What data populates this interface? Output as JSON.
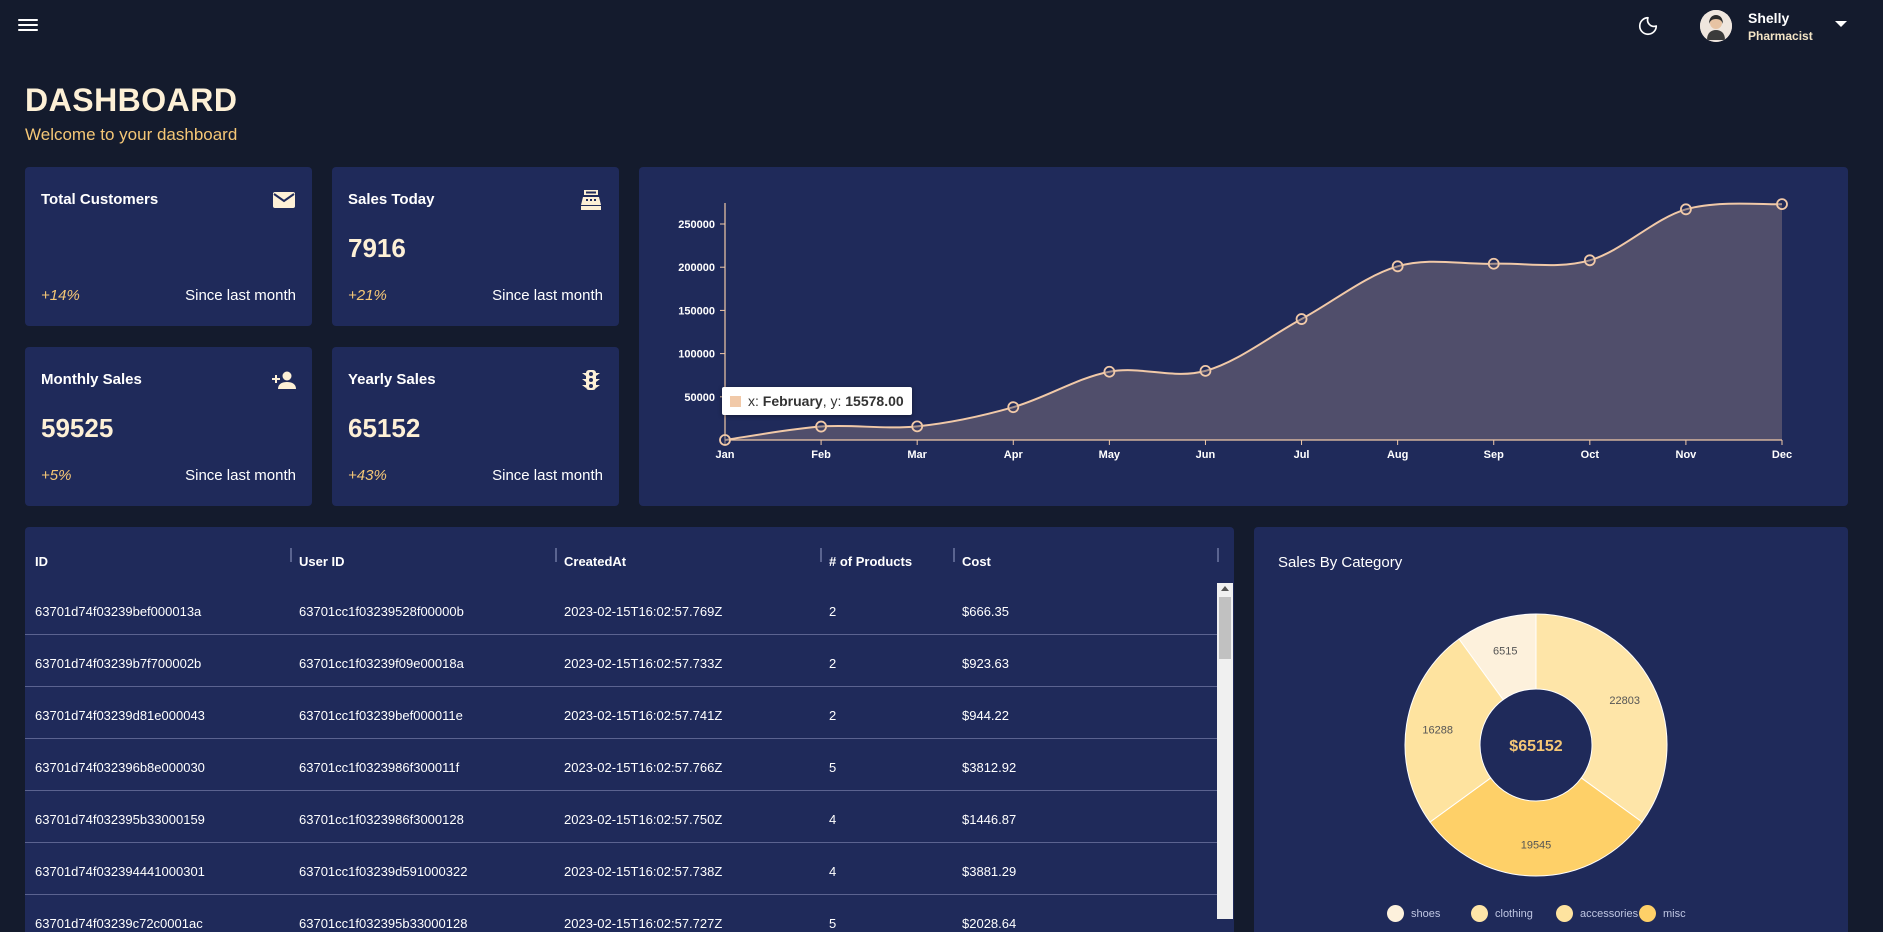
{
  "user": {
    "name": "Shelly",
    "role": "Pharmacist"
  },
  "header": {
    "title": "DASHBOARD",
    "subtitle": "Welcome to your dashboard"
  },
  "stats": [
    {
      "label": "Total Customers",
      "value": "",
      "change": "+14%",
      "since": "Since last month",
      "icon": "mail-icon"
    },
    {
      "label": "Sales Today",
      "value": "7916",
      "change": "+21%",
      "since": "Since last month",
      "icon": "point-of-sale-icon"
    },
    {
      "label": "Monthly Sales",
      "value": "59525",
      "change": "+5%",
      "since": "Since last month",
      "icon": "person-add-icon"
    },
    {
      "label": "Yearly Sales",
      "value": "65152",
      "change": "+43%",
      "since": "Since last month",
      "icon": "traffic-icon"
    }
  ],
  "colors": {
    "background": "#141b2d",
    "panel": "#1f2a5a",
    "accent": "#f5c776",
    "line": "#f1c9a8"
  },
  "chart_data": [
    {
      "type": "area",
      "x": [
        "Jan",
        "Feb",
        "Mar",
        "Apr",
        "May",
        "Jun",
        "Jul",
        "Aug",
        "Sep",
        "Oct",
        "Nov",
        "Dec"
      ],
      "y": [
        0,
        15578,
        15800,
        38000,
        79000,
        80000,
        140000,
        201000,
        204000,
        208000,
        267000,
        273000
      ],
      "y_ticks": [
        50000,
        100000,
        150000,
        200000,
        250000
      ],
      "ylim": [
        0,
        280000
      ],
      "grid": false,
      "tooltip": {
        "prefix_x": "x: ",
        "x": "February",
        "sep": ", y: ",
        "y": "15578.00"
      }
    },
    {
      "type": "pie",
      "title": "Sales By Category",
      "center_label": "$65152",
      "slices": [
        {
          "name": "shoes",
          "value": 6515,
          "color": "#fdf1dc"
        },
        {
          "name": "clothing",
          "value": 22803,
          "color": "#fee5a8"
        },
        {
          "name": "accessories",
          "value": 19545,
          "color": "#fed068"
        },
        {
          "name": "misc",
          "value": 16288,
          "color": "#fee39f"
        }
      ],
      "legend": [
        {
          "name": "shoes",
          "color": "#fdf1dc"
        },
        {
          "name": "clothing",
          "color": "#fee5a8"
        },
        {
          "name": "accessories",
          "color": "#fee39f"
        },
        {
          "name": "misc",
          "color": "#fed068"
        }
      ]
    }
  ],
  "table": {
    "columns": [
      "ID",
      "User ID",
      "CreatedAt",
      "# of Products",
      "Cost"
    ],
    "rows": [
      [
        "63701d74f03239bef000013a",
        "63701cc1f03239528f00000b",
        "2023-02-15T16:02:57.769Z",
        "2",
        "$666.35"
      ],
      [
        "63701d74f03239b7f700002b",
        "63701cc1f03239f09e00018a",
        "2023-02-15T16:02:57.733Z",
        "2",
        "$923.63"
      ],
      [
        "63701d74f03239d81e000043",
        "63701cc1f03239bef000011e",
        "2023-02-15T16:02:57.741Z",
        "2",
        "$944.22"
      ],
      [
        "63701d74f032396b8e000030",
        "63701cc1f0323986f300011f",
        "2023-02-15T16:02:57.766Z",
        "5",
        "$3812.92"
      ],
      [
        "63701d74f032395b33000159",
        "63701cc1f0323986f3000128",
        "2023-02-15T16:02:57.750Z",
        "4",
        "$1446.87"
      ],
      [
        "63701d74f032394441000301",
        "63701cc1f03239d591000322",
        "2023-02-15T16:02:57.738Z",
        "4",
        "$3881.29"
      ],
      [
        "63701d74f03239c72c0001ac",
        "63701cc1f032395b33000128",
        "2023-02-15T16:02:57.727Z",
        "5",
        "$2028.64"
      ]
    ]
  }
}
